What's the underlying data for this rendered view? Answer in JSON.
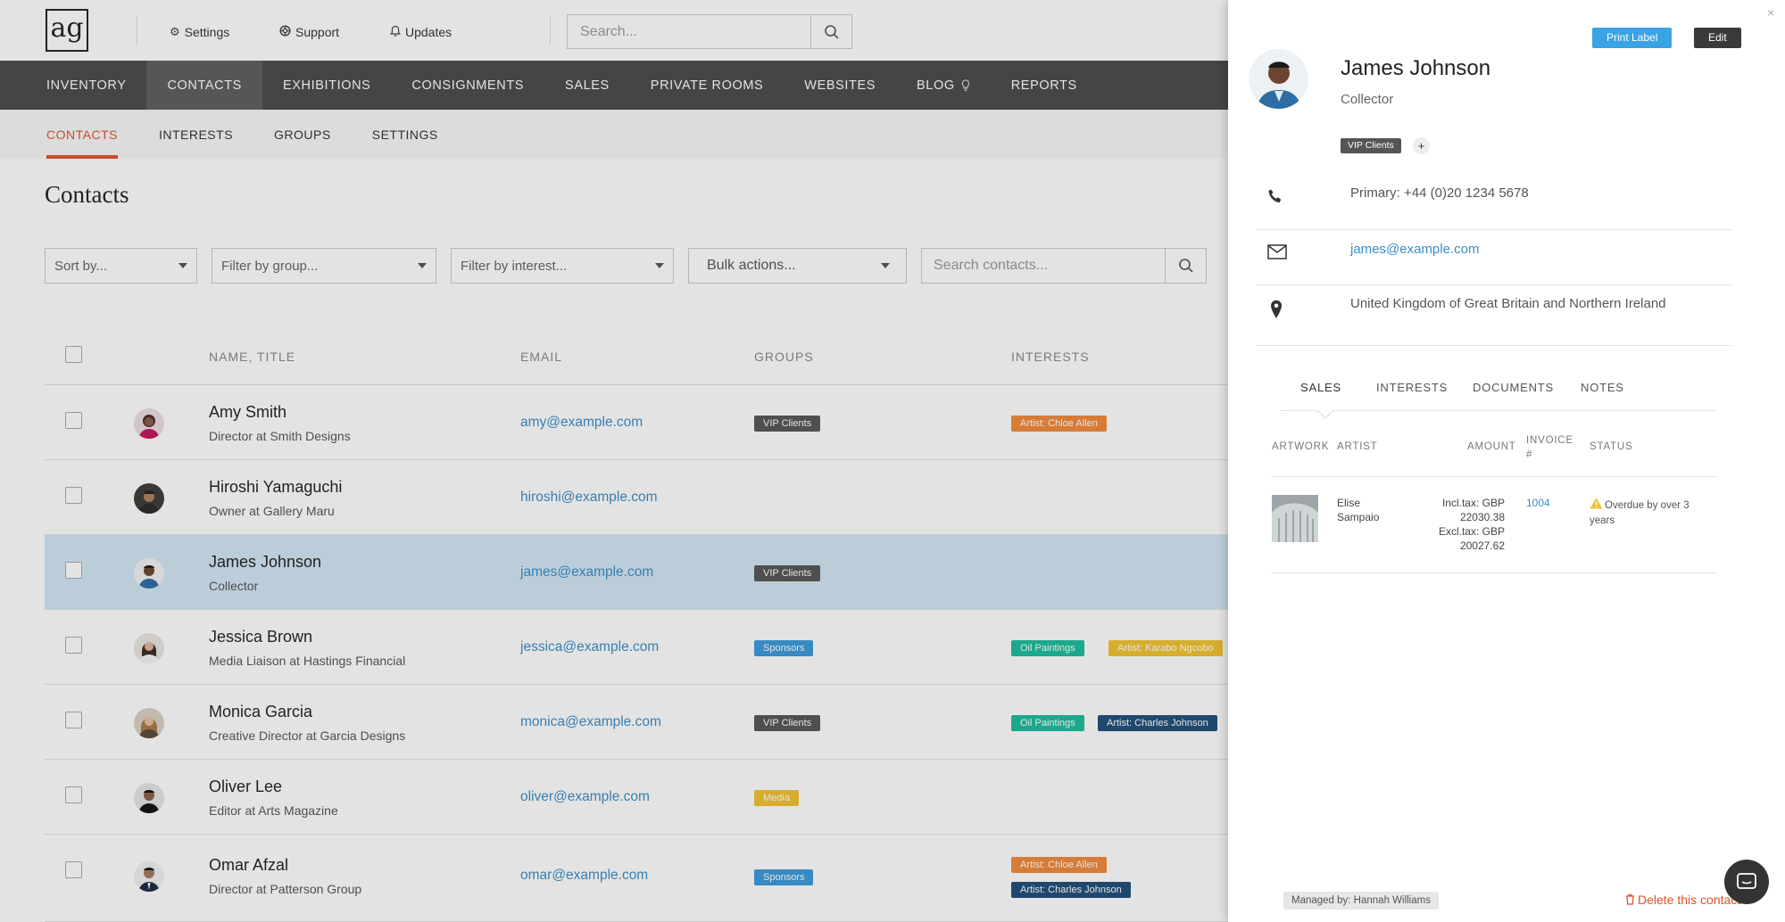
{
  "header": {
    "logo_text": "ag",
    "settings_label": "Settings",
    "support_label": "Support",
    "updates_label": "Updates",
    "search_placeholder": "Search..."
  },
  "main_nav": [
    "INVENTORY",
    "CONTACTS",
    "EXHIBITIONS",
    "CONSIGNMENTS",
    "SALES",
    "PRIVATE ROOMS",
    "WEBSITES",
    "BLOG",
    "REPORTS"
  ],
  "sub_nav": [
    "CONTACTS",
    "INTERESTS",
    "GROUPS",
    "SETTINGS"
  ],
  "page_title": "Contacts",
  "filters": {
    "sort": "Sort by...",
    "group": "Filter by group...",
    "interest": "Filter by interest...",
    "bulk": "Bulk actions...",
    "search_placeholder": "Search contacts..."
  },
  "table": {
    "columns": [
      "NAME, TITLE",
      "EMAIL",
      "GROUPS",
      "INTERESTS"
    ],
    "rows": [
      {
        "name": "Amy Smith",
        "title": "Director at Smith Designs",
        "email": "amy@example.com",
        "group": "VIP Clients",
        "interests": [
          "Artist: Chloe Allen"
        ]
      },
      {
        "name": "Hiroshi Yamaguchi",
        "title": "Owner at Gallery Maru",
        "email": "hiroshi@example.com",
        "group": "",
        "interests": []
      },
      {
        "name": "James Johnson",
        "title": "Collector",
        "email": "james@example.com",
        "group": "VIP Clients",
        "interests": []
      },
      {
        "name": "Jessica Brown",
        "title": "Media Liaison at Hastings Financial",
        "email": "jessica@example.com",
        "group": "Sponsors",
        "interests": [
          "Oil Paintings",
          "Artist: Karabo Ngcobo"
        ]
      },
      {
        "name": "Monica Garcia",
        "title": "Creative Director at Garcia Designs",
        "email": "monica@example.com",
        "group": "VIP Clients",
        "interests": [
          "Oil Paintings",
          "Artist: Charles Johnson"
        ]
      },
      {
        "name": "Oliver Lee",
        "title": "Editor at Arts Magazine",
        "email": "oliver@example.com",
        "group": "Media",
        "interests": []
      },
      {
        "name": "Omar Afzal",
        "title": "Director at Patterson Group",
        "email": "omar@example.com",
        "group": "Sponsors",
        "interests": [
          "Artist: Chloe Allen",
          "Artist: Charles Johnson"
        ]
      }
    ]
  },
  "panel": {
    "close": "×",
    "print_label": "Print Label",
    "edit_label": "Edit",
    "name": "James Johnson",
    "role": "Collector",
    "tag": "VIP Clients",
    "add": "+",
    "phone": "Primary: +44 (0)20 1234 5678",
    "email": "james@example.com",
    "location": "United Kingdom of Great Britain and Northern Ireland",
    "tabs": [
      "SALES",
      "INTERESTS",
      "DOCUMENTS",
      "NOTES"
    ],
    "sales_headers": {
      "artwork": "ARTWORK",
      "artist": "ARTIST",
      "amount": "AMOUNT",
      "invoice_1": "INVOICE",
      "invoice_2": "#",
      "status": "STATUS"
    },
    "sale": {
      "artist_1": "Elise",
      "artist_2": "Sampaio",
      "incl_1": "Incl.tax: GBP",
      "incl_2": "22030.38",
      "excl_1": "Excl.tax: GBP",
      "excl_2": "20027.62",
      "invoice": "1004",
      "status_1": "Overdue by over 3",
      "status_2": "years"
    },
    "managed_by": "Managed by: Hannah Williams",
    "delete": "Delete this contact"
  },
  "colors": {
    "accent": "#e0522d",
    "link": "#3a8dc8",
    "nav_bg": "#4a4a4a",
    "selected_row": "#d2e6f3"
  }
}
